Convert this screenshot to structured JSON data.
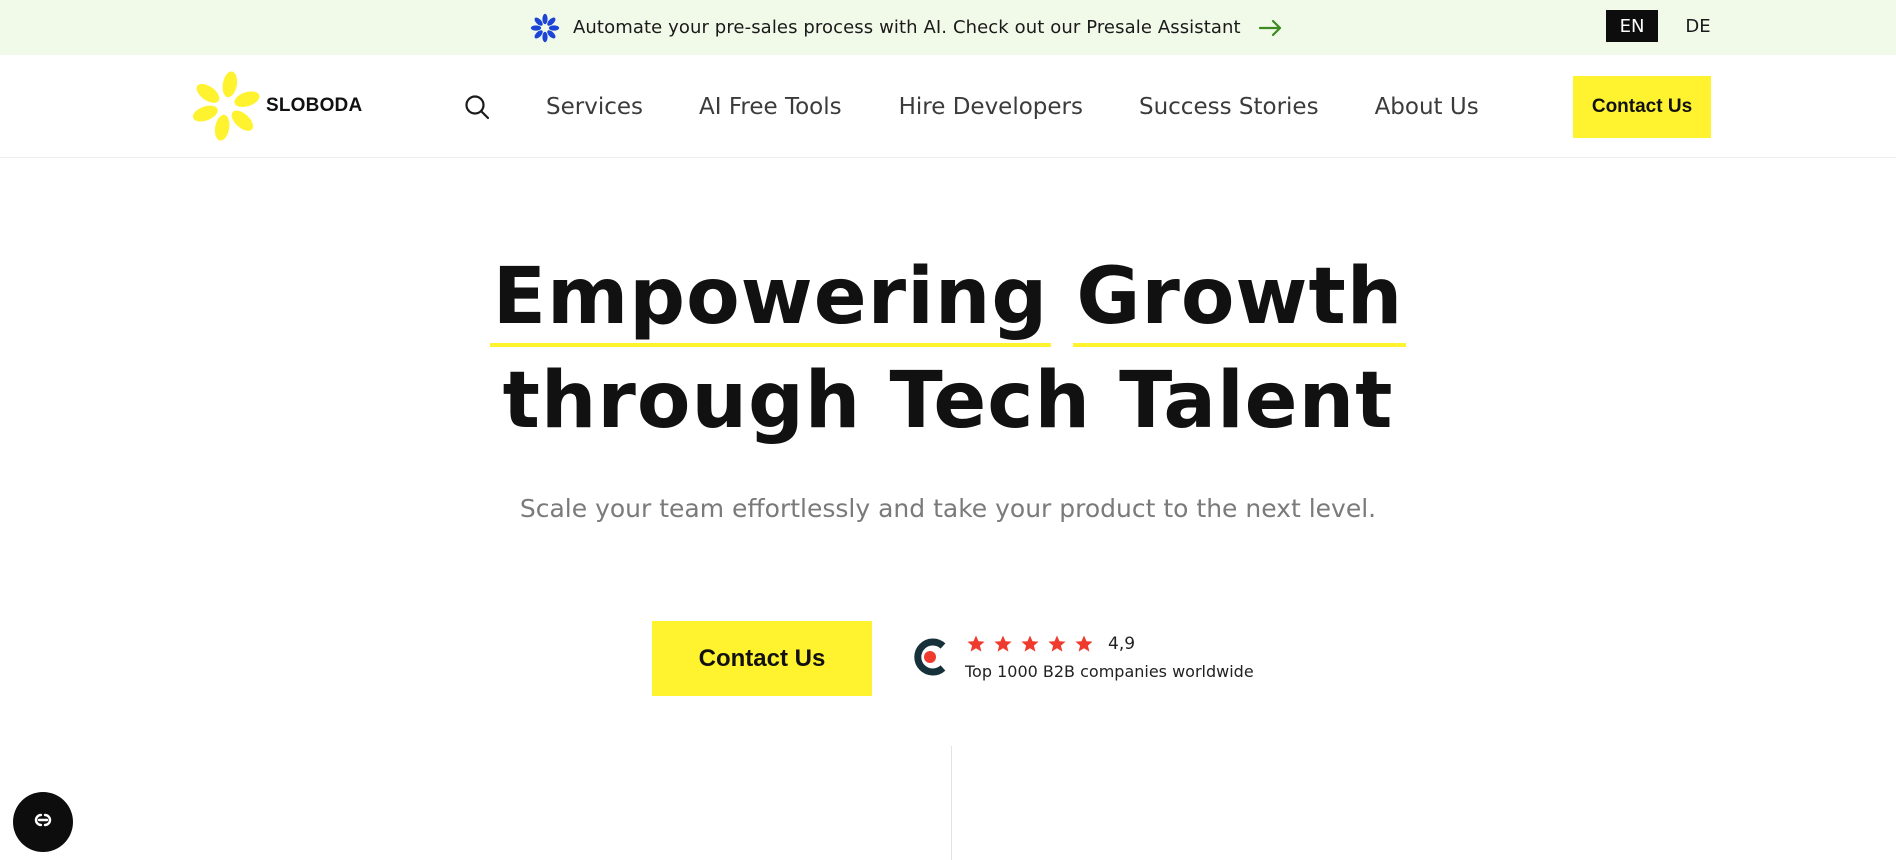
{
  "announcement": {
    "icon": "sparkle-flower-icon",
    "text": "Automate your pre-sales process with AI. Check out our Presale Assistant",
    "arrow_icon": "arrow-right-icon",
    "icon_color": "#1c45d8",
    "arrow_color": "#3d8a1f",
    "background": "#f1f9e9"
  },
  "languages": {
    "en": "EN",
    "de": "DE",
    "active": "EN"
  },
  "header": {
    "logo_text": "SLOBODA",
    "logo_color": "#fff22f",
    "search_icon": "search-icon",
    "nav": {
      "services": "Services",
      "ai_free_tools": "AI Free Tools",
      "hire_developers": "Hire Developers",
      "success_stories": "Success Stories",
      "about_us": "About Us"
    },
    "cta_label": "Contact Us"
  },
  "hero": {
    "title_line1_word1": "Empowering",
    "title_line1_word2": "Growth",
    "title_line2": "through Tech Talent",
    "subtitle": "Scale your team effortlessly and take your product to the next level.",
    "cta_label": "Contact Us",
    "accent_color": "#fff22f"
  },
  "rating": {
    "logo_icon": "clutch-logo-icon",
    "stars": 4.9,
    "star_color": "#ef3b2d",
    "score": "4,9",
    "caption": "Top 1000 B2B companies worldwide"
  },
  "floating_button": {
    "icon": "accessibility-icon"
  }
}
